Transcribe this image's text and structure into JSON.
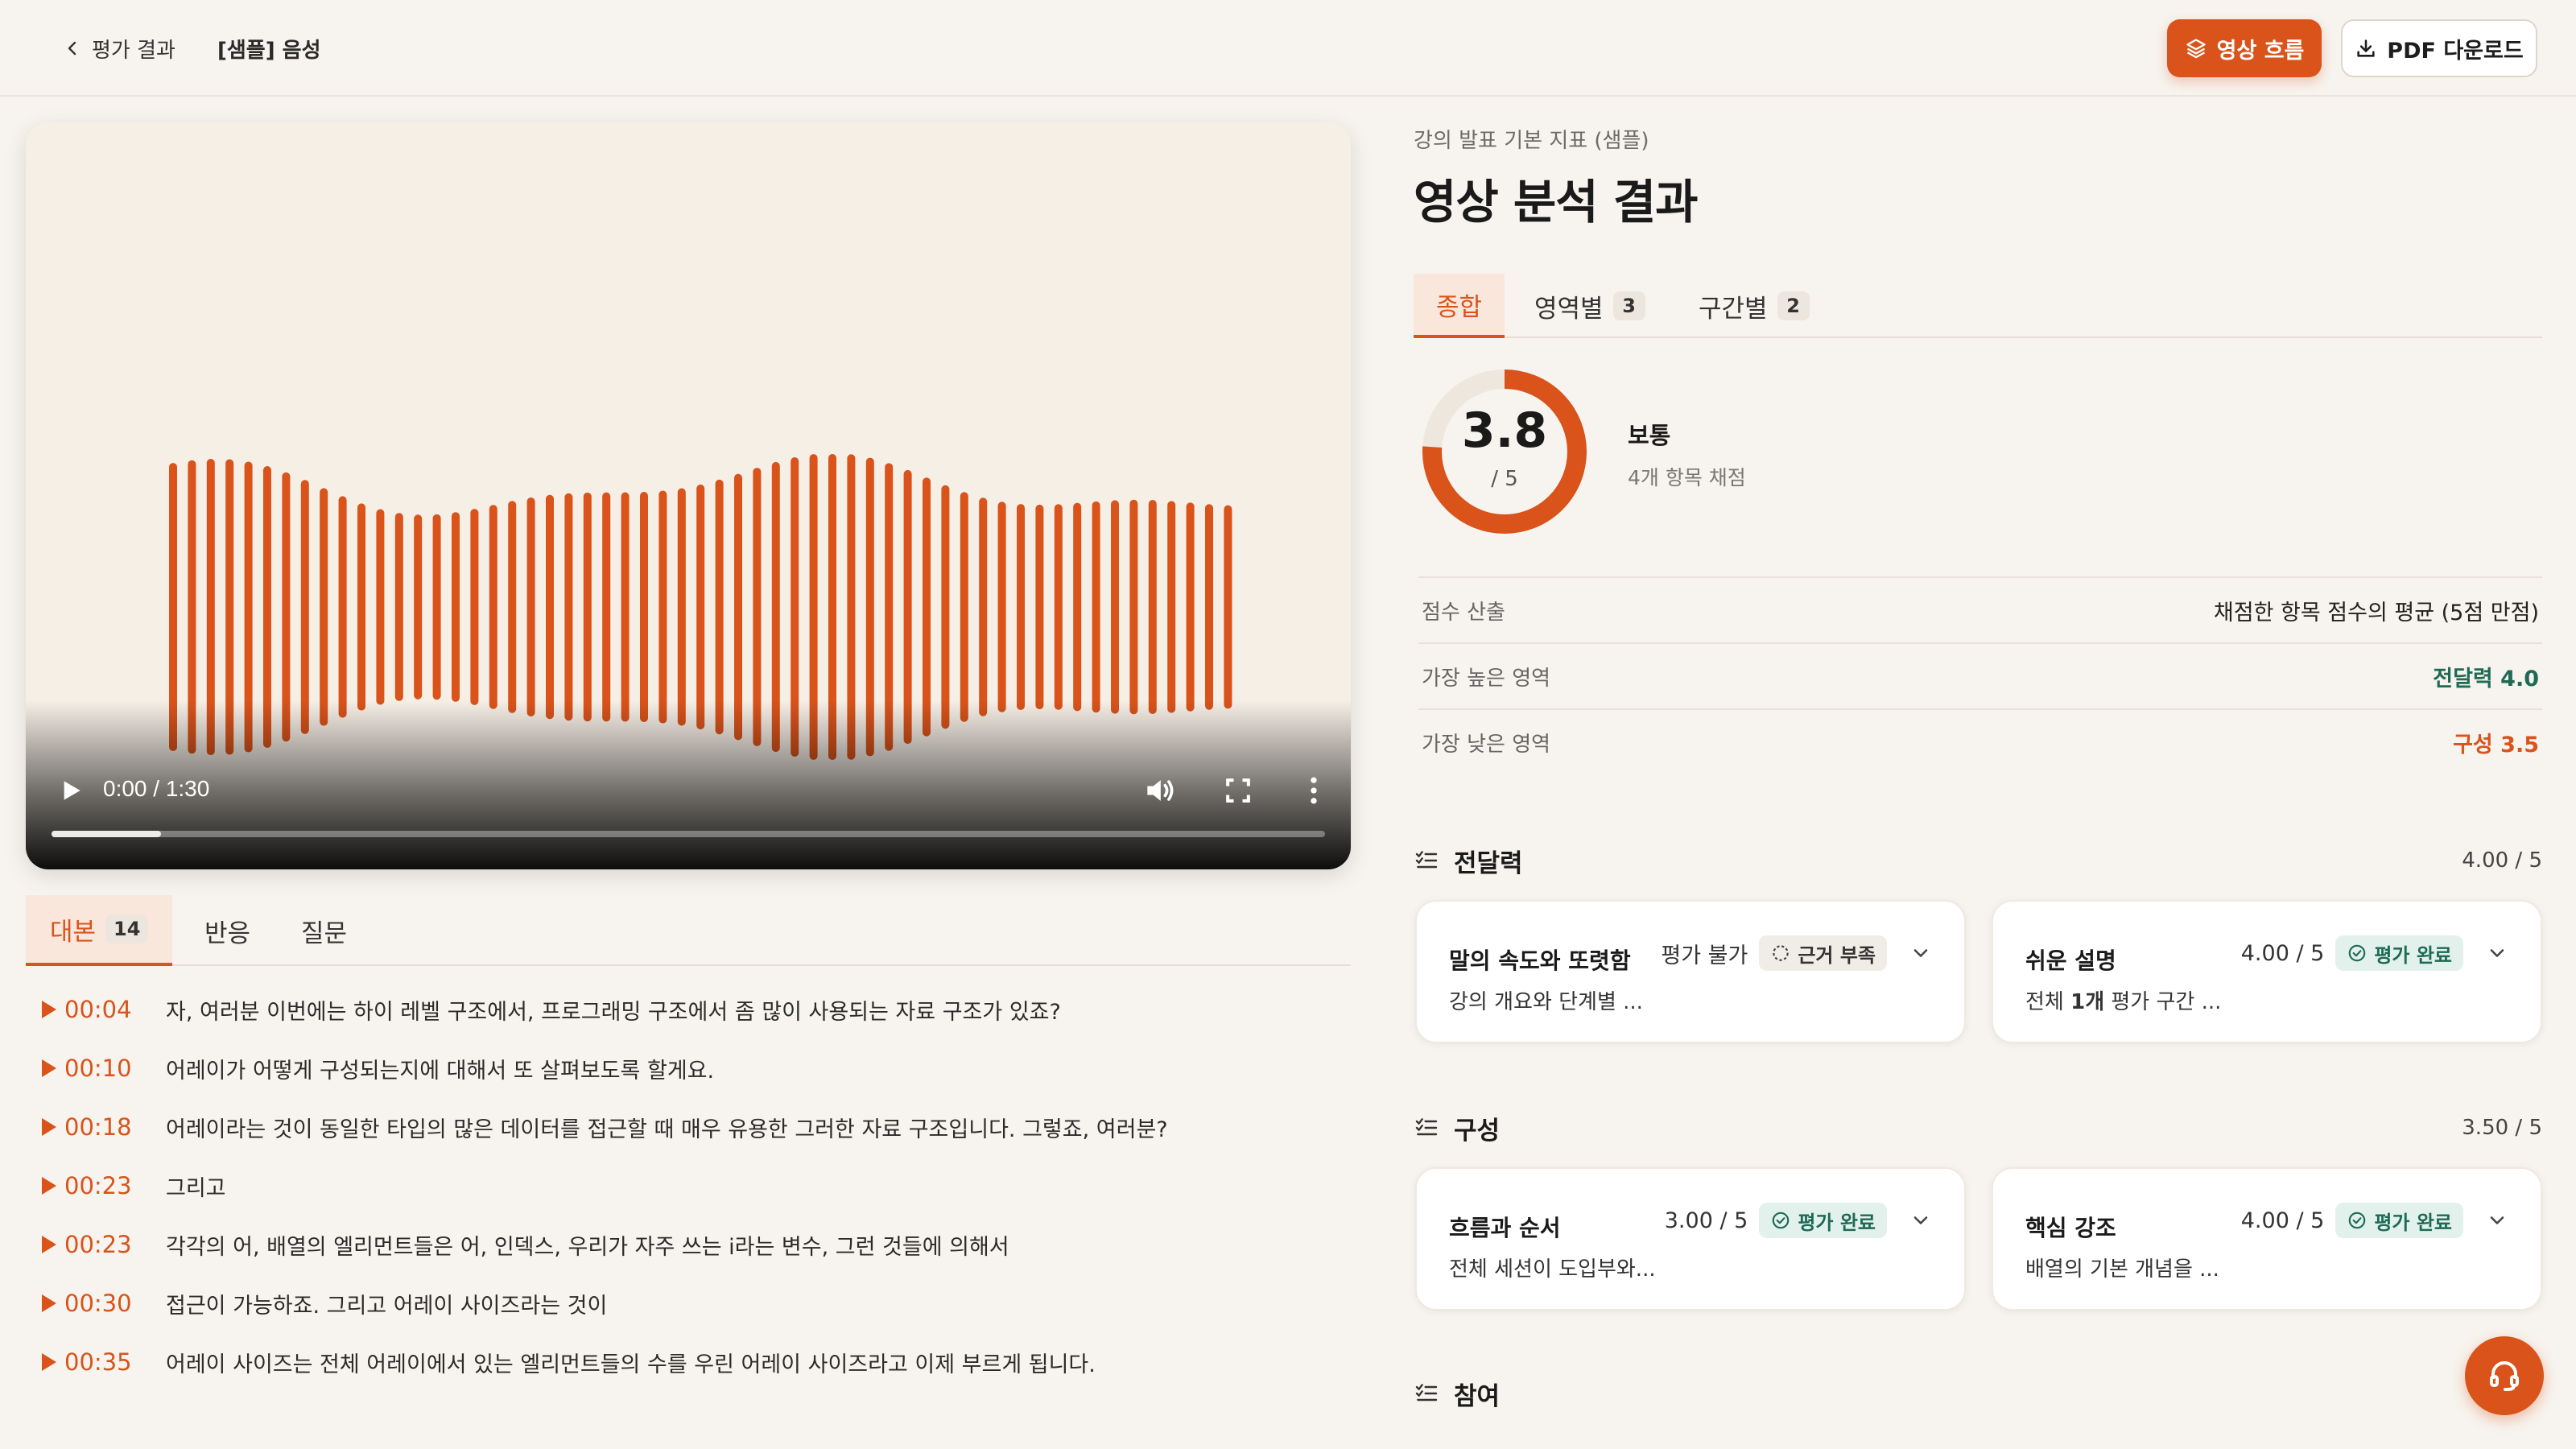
{
  "header": {
    "back_label": "평가 결과",
    "title": "[샘플] 음성",
    "flow_button": "영상 흐름",
    "pdf_button": "PDF 다운로드"
  },
  "player": {
    "time": "0:00 / 1:30",
    "progress": 0.086
  },
  "left_tabs": [
    {
      "label": "대본",
      "count": "14"
    },
    {
      "label": "반응"
    },
    {
      "label": "질문"
    }
  ],
  "transcript": [
    {
      "time": "00:04",
      "text": "자, 여러분 이번에는 하이 레벨 구조에서, 프로그래밍 구조에서 좀 많이 사용되는 자료 구조가 있죠?"
    },
    {
      "time": "00:10",
      "text": "어레이가 어떻게 구성되는지에 대해서 또 살펴보도록 할게요."
    },
    {
      "time": "00:18",
      "text": "어레이라는 것이 동일한 타입의 많은 데이터를 접근할 때 매우 유용한 그러한 자료 구조입니다. 그렇죠, 여러분?"
    },
    {
      "time": "00:23",
      "text": "그리고"
    },
    {
      "time": "00:23",
      "text": "각각의 어, 배열의 엘리먼트들은 어, 인덱스, 우리가 자주 쓰는 i라는 변수, 그런 것들에 의해서"
    },
    {
      "time": "00:30",
      "text": "접근이 가능하죠. 그리고 어레이 사이즈라는 것이"
    },
    {
      "time": "00:35",
      "text": "어레이 사이즈는 전체 어레이에서 있는 엘리먼트들의 수를 우린 어레이 사이즈라고 이제 부르게 됩니다."
    }
  ],
  "summary": {
    "subtitle": "강의 발표 기본 지표 (샘플)",
    "title": "영상 분석 결과",
    "tabs": [
      {
        "label": "종합"
      },
      {
        "label": "영역별",
        "count": "3"
      },
      {
        "label": "구간별",
        "count": "2"
      }
    ],
    "score": "3.8",
    "score_value": 3.8,
    "score_max": 5,
    "score_den": "/ 5",
    "grade": "보통",
    "grade_sub": "4개 항목 채점",
    "rows": [
      {
        "label": "점수 산출",
        "value": "채점한 항목 점수의 평균 (5점 만점)"
      },
      {
        "label": "가장 높은 영역",
        "value": "전달력 4.0"
      },
      {
        "label": "가장 낮은 영역",
        "value": "구성 3.5"
      }
    ]
  },
  "sections": [
    {
      "title": "전달력",
      "score": "4.00 / 5",
      "cards": [
        {
          "title": "말의 속도와 또렷함",
          "score": "평가 불가",
          "status": "근거 부족",
          "desc": "강의 개요와 단계별 ..."
        },
        {
          "title": "쉬운 설명",
          "score": "4.00 / 5",
          "status": "평가 완료",
          "desc_pre": "전체 ",
          "desc_bold": "1개",
          "desc_post": " 평가 구간 ..."
        }
      ]
    },
    {
      "title": "구성",
      "score": "3.50 / 5",
      "cards": [
        {
          "title": "흐름과 순서",
          "score": "3.00 / 5",
          "status": "평가 완료",
          "desc": "전체 세션이 도입부와..."
        },
        {
          "title": "핵심 강조",
          "score": "4.00 / 5",
          "status": "평가 완료",
          "desc": "배열의 기본 개념을 ..."
        }
      ]
    },
    {
      "title": "참여"
    }
  ],
  "colors": {
    "accent": "#d9531b",
    "success": "#1e6a55",
    "background": "#f7f3ee"
  }
}
